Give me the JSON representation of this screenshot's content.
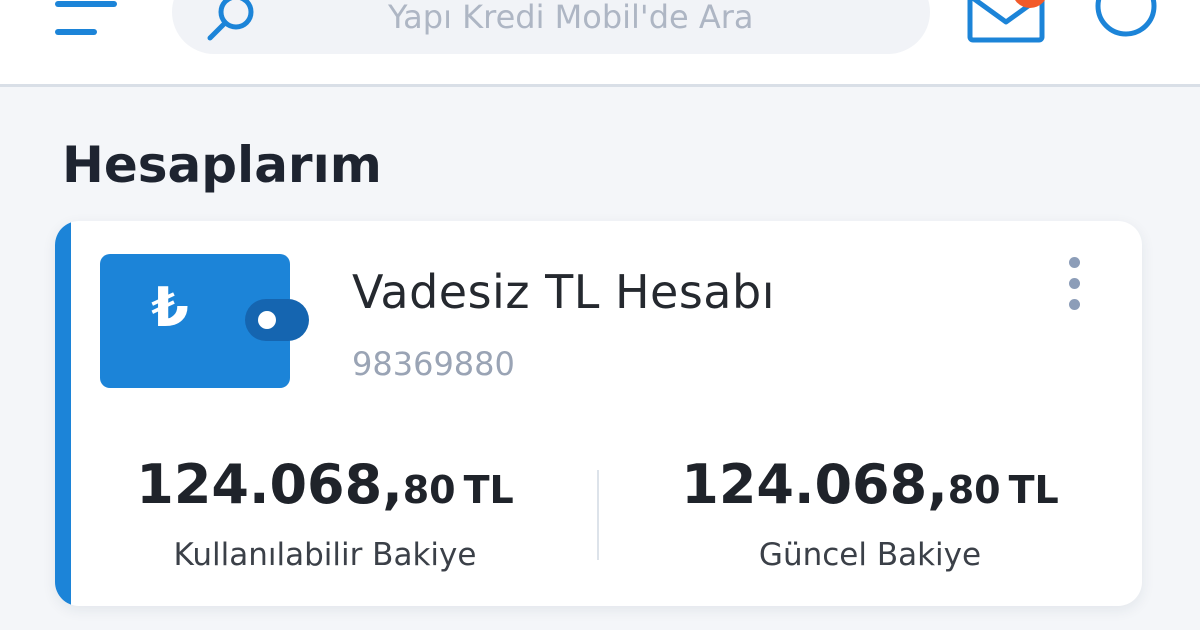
{
  "header": {
    "search_placeholder": "Yapı Kredi Mobil'de Ara",
    "icons": [
      "menu-icon",
      "search-icon",
      "mail-icon",
      "profile-icon"
    ],
    "accent_color": "#1c84d8",
    "badge_color": "#f25a2a"
  },
  "section": {
    "title": "Hesaplarım"
  },
  "account": {
    "icon": "wallet-lira-icon",
    "currency_symbol": "₺",
    "name": "Vadesiz TL Hesabı",
    "number": "98369880",
    "available": {
      "integer": "124.068,",
      "decimal": "80",
      "currency": "TL",
      "label": "Kullanılabilir Bakiye"
    },
    "current": {
      "integer": "124.068,",
      "decimal": "80",
      "currency": "TL",
      "label": "Güncel Bakiye"
    }
  }
}
